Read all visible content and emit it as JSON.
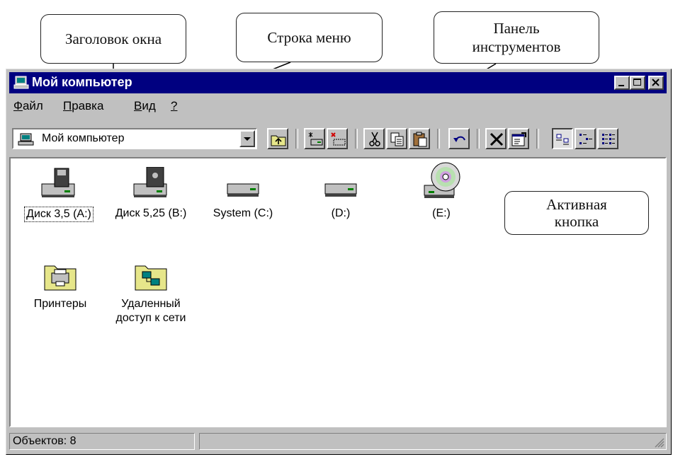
{
  "annotations": {
    "window_title": "Заголовок окна",
    "menu_bar": "Строка меню",
    "toolbar": "Панель\nинструментов",
    "active_button": "Активная\nкнопка"
  },
  "window": {
    "title": "Мой компьютер",
    "controls": [
      "minimize",
      "maximize",
      "close"
    ]
  },
  "menu": {
    "items": [
      {
        "accel": "Ф",
        "rest": "айл"
      },
      {
        "accel": "П",
        "rest": "равка"
      },
      {
        "accel": "В",
        "rest": "ид"
      },
      {
        "accel": "?",
        "rest": ""
      }
    ]
  },
  "toolbar": {
    "address_value": "Мой компьютер",
    "buttons": [
      "up-folder",
      "map-drive",
      "disconnect-drive",
      "cut",
      "copy",
      "paste",
      "undo",
      "delete",
      "properties",
      "large-icons",
      "small-icons",
      "list-view"
    ],
    "active_button": "large-icons"
  },
  "items": [
    {
      "label": "Диск 3,5 (A:)",
      "icon": "floppy-35-icon",
      "selected": true
    },
    {
      "label": "Диск 5,25 (B:)",
      "icon": "floppy-525-icon"
    },
    {
      "label": "System (C:)",
      "icon": "hard-drive-icon"
    },
    {
      "label": "(D:)",
      "icon": "hard-drive-icon"
    },
    {
      "label": "(E:)",
      "icon": "cd-drive-icon"
    },
    {
      "label": "Принтеры",
      "icon": "printers-folder-icon"
    },
    {
      "label": "Удаленный\nдоступ к сети",
      "icon": "dialup-networking-icon"
    }
  ],
  "status": {
    "objects": "Объектов: 8"
  },
  "colors": {
    "title_bar": "#000080",
    "window_face": "#c0c0c0",
    "folder": "#e6e68a"
  }
}
